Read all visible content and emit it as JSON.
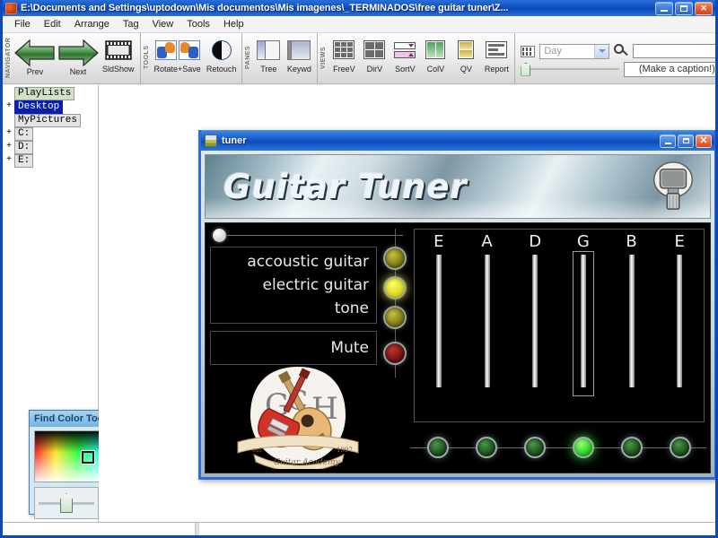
{
  "window": {
    "title": "E:\\Documents and Settings\\uptodown\\Mis documentos\\Mis imagenes\\_TERMINADOS\\free guitar tuner\\Z...",
    "icon": "app-icon",
    "buttons": {
      "minimize": "_",
      "maximize": "▫",
      "close": "✕"
    }
  },
  "menubar": {
    "items": [
      {
        "label": "File"
      },
      {
        "label": "Edit"
      },
      {
        "label": "Arrange"
      },
      {
        "label": "Tag"
      },
      {
        "label": "View"
      },
      {
        "label": "Tools"
      },
      {
        "label": "Help"
      }
    ]
  },
  "toolbar": {
    "groups": [
      {
        "name": "NAVIGATOR",
        "buttons": [
          {
            "label": "Prev",
            "icon": "arrow-left-icon"
          },
          {
            "label": "Next",
            "icon": "arrow-right-icon"
          },
          {
            "label": "SldShow",
            "icon": "filmstrip-icon"
          }
        ]
      },
      {
        "name": "TOOLS",
        "buttons": [
          {
            "label": "Rotate+Save",
            "icon": "rotate-save-icon"
          },
          {
            "label": "Retouch",
            "icon": "contrast-icon"
          }
        ]
      },
      {
        "name": "PANES",
        "buttons": [
          {
            "label": "Tree",
            "icon": "tree-pane-icon"
          },
          {
            "label": "Keywd",
            "icon": "keyword-pane-icon"
          }
        ]
      },
      {
        "name": "VIEWS",
        "buttons": [
          {
            "label": "FreeV",
            "icon": "free-view-icon"
          },
          {
            "label": "DirV",
            "icon": "dir-view-icon"
          },
          {
            "label": "SortV",
            "icon": "sort-view-icon"
          },
          {
            "label": "ColV",
            "icon": "column-view-icon"
          },
          {
            "label": "QV",
            "icon": "quick-view-icon"
          },
          {
            "label": "Report",
            "icon": "report-view-icon"
          }
        ]
      }
    ],
    "period_select": {
      "value": "Day",
      "icon": "calendar-icon"
    },
    "search": {
      "value": "",
      "placeholder": "",
      "icon": "search-icon"
    },
    "caption": {
      "value": "(Make a caption!)"
    },
    "zoom_slider": {
      "value": 0
    }
  },
  "navigator_tree": {
    "items": [
      {
        "label": "PlayLists",
        "expander": "",
        "selected": false
      },
      {
        "label": "Desktop",
        "expander": "+",
        "selected": true
      },
      {
        "label": "MyPictures",
        "expander": "",
        "selected": false
      },
      {
        "label": "C:",
        "expander": "+",
        "selected": false
      },
      {
        "label": "D:",
        "expander": "+",
        "selected": false
      },
      {
        "label": "E:",
        "expander": "+",
        "selected": false
      }
    ]
  },
  "tuner_window": {
    "title": "tuner",
    "icon": "tuner-app-icon",
    "buttons": {
      "minimize": "_",
      "maximize": "▫",
      "close": "✕"
    },
    "header": {
      "title": "Guitar Tuner",
      "mic_icon": "microphone-icon"
    },
    "modes": [
      {
        "label": "accoustic guitar",
        "led": "yellow-dim",
        "active": false
      },
      {
        "label": "electric guitar",
        "led": "yellow-on",
        "active": true
      },
      {
        "label": "tone",
        "led": "yellow-dim",
        "active": false
      }
    ],
    "mute": {
      "label": "Mute",
      "led": "red-dim",
      "active": false
    },
    "strings": [
      {
        "note": "E",
        "selected": false,
        "led": "green-dim"
      },
      {
        "note": "A",
        "selected": false,
        "led": "green-dim"
      },
      {
        "note": "D",
        "selected": false,
        "led": "green-dim"
      },
      {
        "note": "G",
        "selected": true,
        "led": "green-on"
      },
      {
        "note": "B",
        "selected": false,
        "led": "green-dim"
      },
      {
        "note": "E",
        "selected": false,
        "led": "green-dim"
      }
    ],
    "logo": {
      "letters": [
        "G",
        "C",
        "H"
      ],
      "icon": "guitar-academy-logo"
    }
  },
  "find_color_tool": {
    "title": "Find Color Tool",
    "close_label": "✕",
    "swatch_color": "#4fb3b0",
    "cursor_icon": "color-picker-cursor"
  },
  "statusbar": {
    "text": ""
  },
  "colors": {
    "titlebar_blue": "#0b4fc4",
    "accent_green": "#2fd42f",
    "accent_yellow": "#fdfd63",
    "panel_black": "#000000"
  }
}
